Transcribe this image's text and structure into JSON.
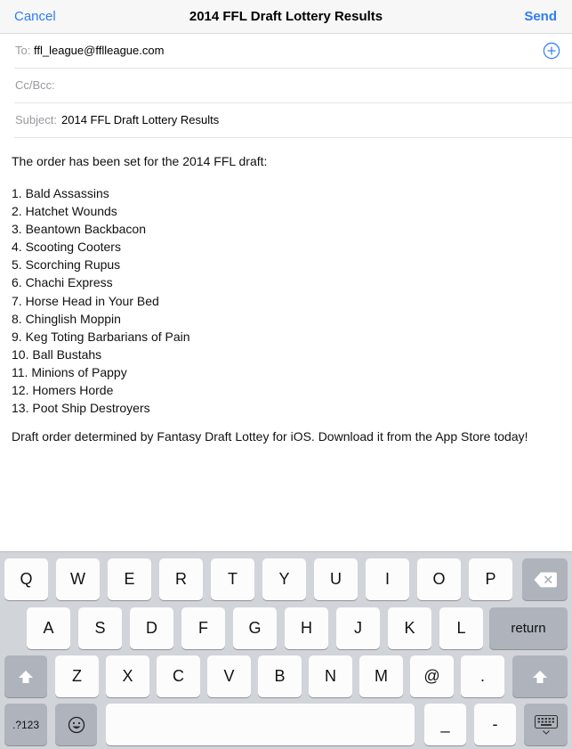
{
  "nav": {
    "cancel_label": "Cancel",
    "title": "2014 FFL Draft Lottery Results",
    "send_label": "Send"
  },
  "fields": {
    "to_label": "To:",
    "to_value": "ffl_league@fflleague.com",
    "cc_label": "Cc/Bcc:",
    "subject_label": "Subject:",
    "subject_value": "2014 FFL Draft Lottery Results"
  },
  "body": {
    "intro": "The order has been set for the 2014 FFL draft:",
    "teams": [
      "1. Bald Assassins",
      "2. Hatchet Wounds",
      "3. Beantown Backbacon",
      "4. Scooting Cooters",
      "5. Scorching Rupus",
      "6. Chachi Express",
      "7. Horse Head in Your Bed",
      "8. Chinglish Moppin",
      "9. Keg Toting Barbarians of Pain",
      "10. Ball Bustahs",
      "11. Minions of Pappy",
      "12. Homers Horde",
      "13. Poot Ship Destroyers"
    ],
    "footer": "Draft order determined by Fantasy Draft Lottey for iOS. Download it from the App Store today!"
  },
  "keyboard": {
    "row1": [
      "Q",
      "W",
      "E",
      "R",
      "T",
      "Y",
      "U",
      "I",
      "O",
      "P"
    ],
    "row2": [
      "A",
      "S",
      "D",
      "F",
      "G",
      "H",
      "J",
      "K",
      "L"
    ],
    "return_label": "return",
    "row3": [
      "Z",
      "X",
      "C",
      "V",
      "B",
      "N",
      "M",
      "@",
      "."
    ],
    "numbers_label": ".?123",
    "underscore": "_",
    "hyphen": "-",
    "icons": {
      "delete": "delete-icon",
      "shift": "shift-icon",
      "emoji": "emoji-icon",
      "dismiss": "keyboard-dismiss-icon",
      "add_contact": "add-contact-icon"
    }
  },
  "colors": {
    "accent": "#2f7cf6",
    "keyboard_bg": "#d1d4d9",
    "key_light": "#fcfcfd",
    "key_dark": "#aeb3bc"
  }
}
